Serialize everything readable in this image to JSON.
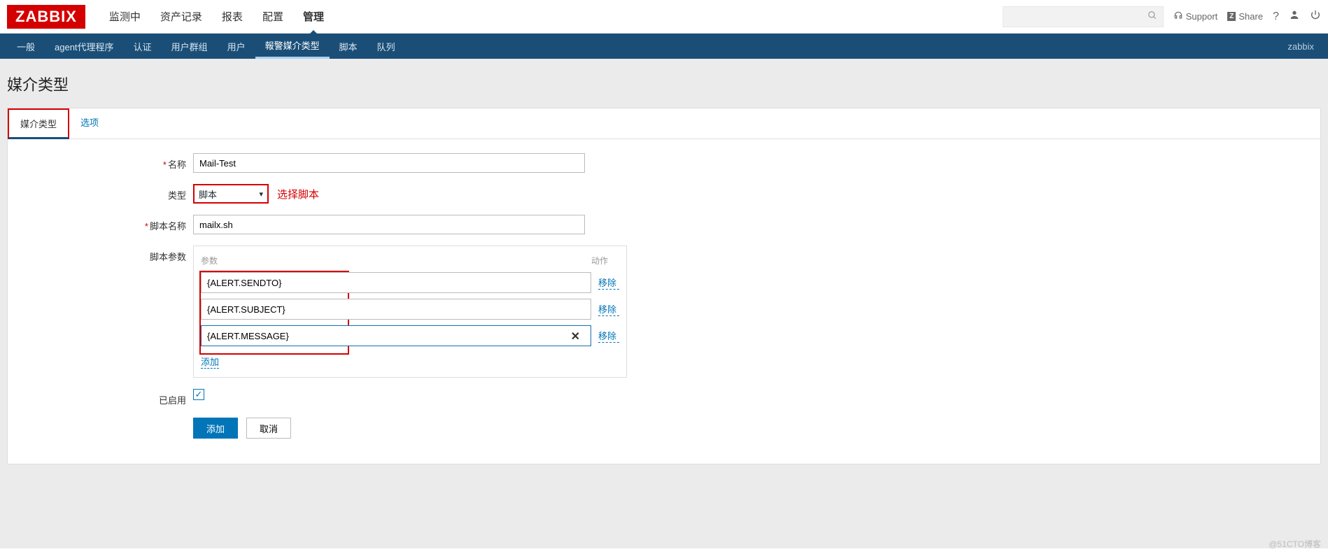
{
  "brand": "ZABBIX",
  "main_nav": {
    "items": [
      "监测中",
      "资产记录",
      "报表",
      "配置",
      "管理"
    ],
    "active_index": 4
  },
  "top_right": {
    "support": "Support",
    "share": "Share"
  },
  "sub_nav": {
    "items": [
      "一般",
      "agent代理程序",
      "认证",
      "用户群组",
      "用户",
      "報警媒介类型",
      "脚本",
      "队列"
    ],
    "active_index": 5,
    "right": "zabbix"
  },
  "page": {
    "title": "媒介类型"
  },
  "tabs": {
    "items": [
      "媒介类型",
      "选项"
    ],
    "active_index": 0
  },
  "form": {
    "name_label": "名称",
    "name_value": "Mail-Test",
    "type_label": "类型",
    "type_value": "脚本",
    "type_annotation": "选择脚本",
    "script_label": "脚本名称",
    "script_value": "mailx.sh",
    "params_label": "脚本参数",
    "params_header_param": "参数",
    "params_header_action": "动作",
    "params": [
      {
        "value": "{ALERT.SENDTO}"
      },
      {
        "value": "{ALERT.SUBJECT}"
      },
      {
        "value": "{ALERT.MESSAGE}",
        "active": true
      }
    ],
    "remove_label": "移除",
    "add_param_label": "添加",
    "enabled_label": "已启用",
    "enabled_checked": true,
    "submit_label": "添加",
    "cancel_label": "取消"
  },
  "watermark": "@51CTO博客"
}
